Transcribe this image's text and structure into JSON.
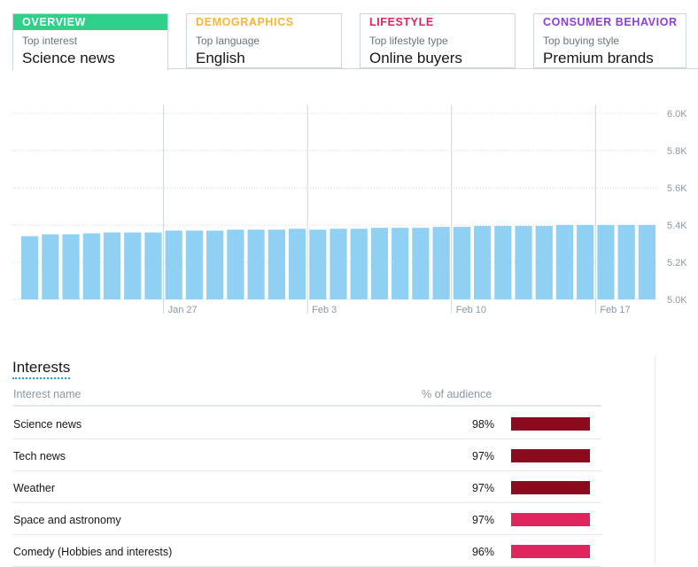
{
  "tabs": [
    {
      "name": "OVERVIEW",
      "sub": "Top interest",
      "value": "Science news",
      "color": "#2fd08a",
      "active": true
    },
    {
      "name": "DEMOGRAPHICS",
      "sub": "Top language",
      "value": "English",
      "color": "#f5b631"
    },
    {
      "name": "LIFESTYLE",
      "sub": "Top lifestyle type",
      "value": "Online buyers",
      "color": "#e0245e"
    },
    {
      "name": "CONSUMER BEHAVIOR",
      "sub": "Top buying style",
      "value": "Premium brands",
      "color": "#8b3ed8"
    }
  ],
  "chart_data": {
    "type": "bar",
    "values": [
      5.34,
      5.35,
      5.35,
      5.355,
      5.36,
      5.36,
      5.36,
      5.37,
      5.37,
      5.37,
      5.375,
      5.375,
      5.375,
      5.38,
      5.375,
      5.38,
      5.38,
      5.385,
      5.385,
      5.385,
      5.39,
      5.39,
      5.395,
      5.395,
      5.395,
      5.395,
      5.4,
      5.4,
      5.4,
      5.4,
      5.4
    ],
    "x_ticks": [
      "Jan 27",
      "Feb 3",
      "Feb 10",
      "Feb 17"
    ],
    "x_tick_indices": [
      6,
      13,
      20,
      27
    ],
    "y_ticks": [
      "6.0K",
      "5.8K",
      "5.6K",
      "5.4K",
      "5.2K",
      "5.0K"
    ],
    "ylim": [
      5.0,
      6.0
    ],
    "bar_color": "#8fd0f3",
    "grid": true
  },
  "interests": {
    "title": "Interests",
    "col_name": "Interest name",
    "col_pct": "% of audience",
    "rows": [
      {
        "name": "Science news",
        "pct": "98%",
        "color": "#8b0a1e"
      },
      {
        "name": "Tech news",
        "pct": "97%",
        "color": "#8b0a1e"
      },
      {
        "name": "Weather",
        "pct": "97%",
        "color": "#8b0a1e"
      },
      {
        "name": "Space and astronomy",
        "pct": "97%",
        "color": "#e0245e"
      },
      {
        "name": "Comedy (Hobbies and interests)",
        "pct": "96%",
        "color": "#e0245e"
      }
    ]
  }
}
